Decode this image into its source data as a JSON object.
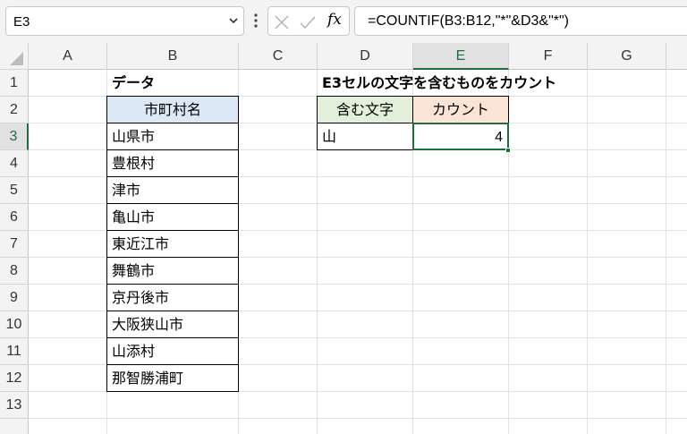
{
  "formula_bar": {
    "name_box": "E3",
    "formula": "=COUNTIF(B3:B12,\"*\"&D3&\"*\")",
    "fx_label": "fx"
  },
  "columns": [
    "A",
    "B",
    "C",
    "D",
    "E",
    "F",
    "G"
  ],
  "rows": [
    "1",
    "2",
    "3",
    "4",
    "5",
    "6",
    "7",
    "8",
    "9",
    "10",
    "11",
    "12",
    "13"
  ],
  "selected_cell": "E3",
  "cells": {
    "b1": "データ",
    "d1": "E3セルの文字を含むものをカウント",
    "b2": "市町村名",
    "d2": "含む文字",
    "e2": "カウント",
    "d3": "山",
    "e3": "4",
    "list": [
      "山県市",
      "豊根村",
      "津市",
      "亀山市",
      "東近江市",
      "舞鶴市",
      "京丹後市",
      "大阪狭山市",
      "山添村",
      "那智勝浦町"
    ]
  },
  "colors": {
    "accent": "#1e6e3b",
    "header_blue": "#dde8f5",
    "header_green": "#e2efda",
    "header_orange": "#fbe4d5"
  }
}
